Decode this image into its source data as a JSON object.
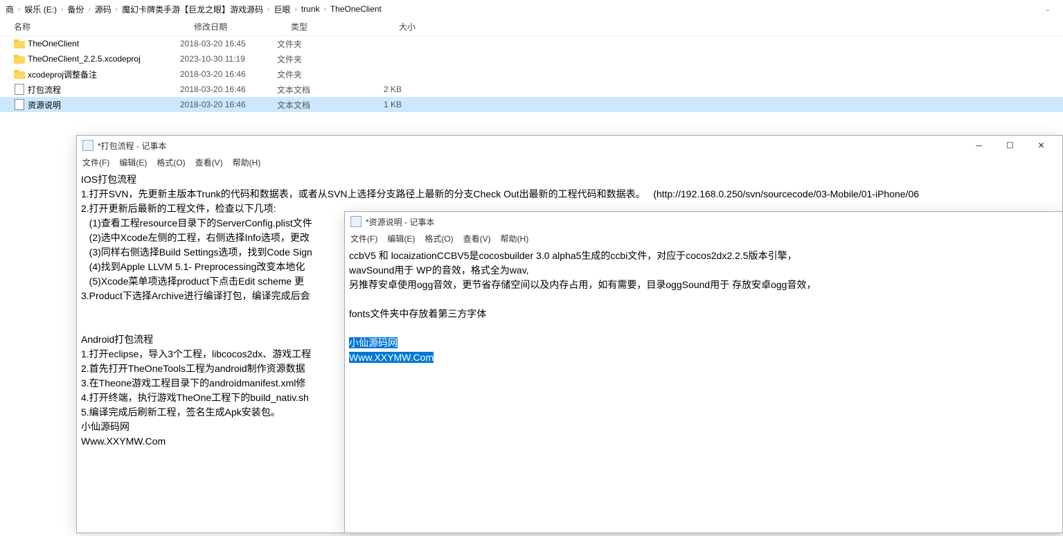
{
  "breadcrumb": [
    "商",
    "娱乐 (E:)",
    "备份",
    "源码",
    "魔幻卡牌类手游【巨龙之眼】游戏源码",
    "巨眼",
    "trunk",
    "TheOneClient"
  ],
  "columns": {
    "name": "名称",
    "date": "修改日期",
    "type": "类型",
    "size": "大小"
  },
  "files": [
    {
      "name": "TheOneClient",
      "date": "2018-03-20 16:45",
      "type": "文件夹",
      "size": "",
      "icon": "folder"
    },
    {
      "name": "TheOneClient_2.2.5.xcodeproj",
      "date": "2023-10-30 11:19",
      "type": "文件夹",
      "size": "",
      "icon": "folder"
    },
    {
      "name": "xcodeproj调整备注",
      "date": "2018-03-20 16:46",
      "type": "文件夹",
      "size": "",
      "icon": "folder"
    },
    {
      "name": "打包流程",
      "date": "2018-03-20 16:46",
      "type": "文本文档",
      "size": "2 KB",
      "icon": "text"
    },
    {
      "name": "资源说明",
      "date": "2018-03-20 16:46",
      "type": "文本文档",
      "size": "1 KB",
      "icon": "text",
      "selected": true
    }
  ],
  "notepad1": {
    "title": "*打包流程 - 记事本",
    "menus": [
      "文件(F)",
      "编辑(E)",
      "格式(O)",
      "查看(V)",
      "帮助(H)"
    ],
    "body": "IOS打包流程\n1.打开SVN，先更新主版本Trunk的代码和数据表，或者从SVN上选择分支路径上最新的分支Check Out出最新的工程代码和数据表。   (http://192.168.0.250/svn/sourcecode/03-Mobile/01-iPhone/06\n2.打开更新后最新的工程文件，检查以下几项:\n   (1)查看工程resource目录下的ServerConfig.plist文件\n   (2)选中Xcode左侧的工程，右侧选择Info选项，更改\n   (3)同样右侧选择Build Settings选项，找到Code Sign\n   (4)找到Apple LLVM 5.1- Preprocessing改变本地化\n   (5)Xcode菜单项选择product下点击Edit scheme 更\n3.Product下选择Archive进行编译打包，编译完成后会\n\n\nAndroid打包流程\n1.打开eclipse，导入3个工程，libcocos2dx、游戏工程\n2.首先打开TheOneTools工程为android制作资源数据\n3.在Theone游戏工程目录下的androidmanifest.xml修\n4.打开终端，执行游戏TheOne工程下的build_nativ.sh\n5.编译完成后刷新工程，签名生成Apk安装包。\n小仙源码网\nWww.XXYMW.Com"
  },
  "notepad2": {
    "title": "*资源说明 - 记事本",
    "menus": [
      "文件(F)",
      "编辑(E)",
      "格式(O)",
      "查看(V)",
      "帮助(H)"
    ],
    "body_before": "ccbV5 和 locaizationCCBV5是cocosbuilder 3.0 alpha5生成的ccbi文件，对应于cocos2dx2.2.5版本引擎，\nwavSound用于 WP的音效，格式全为wav,\n另推荐安卓使用ogg音效，更节省存储空间以及内存占用，如有需要，目录oggSound用于 存放安卓ogg音效，\n\nfonts文件夹中存放着第三方字体\n\n",
    "highlight1": "小仙源码网",
    "highlight2": "Www.XXYMW.Com"
  }
}
